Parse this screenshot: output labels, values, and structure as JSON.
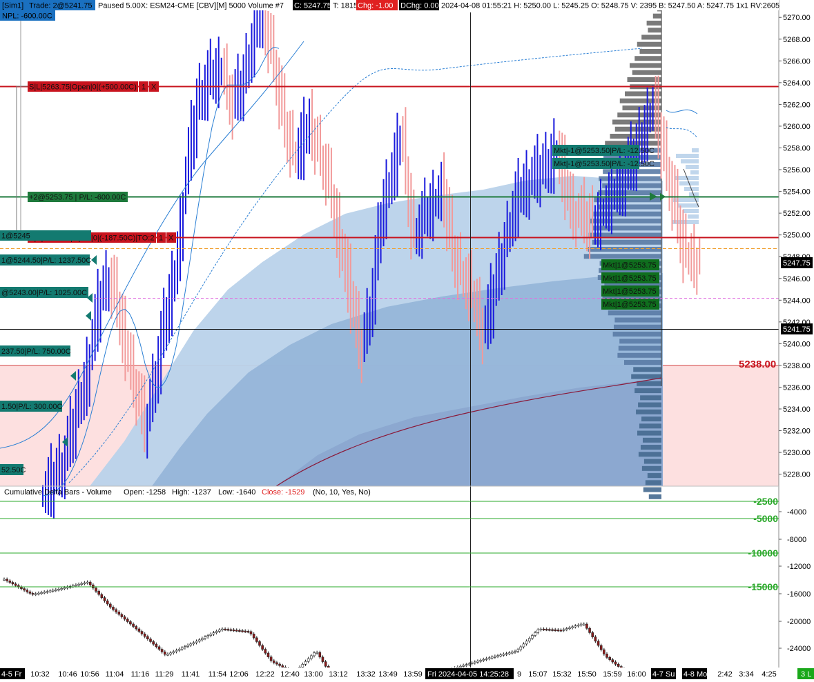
{
  "header": {
    "sim": "[Sim1]",
    "trade": "Trade: 2@5241.75",
    "paused": "Paused 5.00X: ESM24-CME [CBV][M]  5000 Volume #7",
    "close": "C: 5247.75",
    "ticks": "T: 1815",
    "chg": "Chg: -1.00",
    "dchg": "DChg: 0.00",
    "stats": "2024-04-08 01:55:21  H: 5250.00  L: 5245.25  O: 5248.75  V: 2395  B: 5247.50  A: 5247.75  1x1  RV:2605",
    "npl": "NPL: -600.00C"
  },
  "colors": {
    "up_bar": "#1a1adc",
    "down_bar": "#f29a9a",
    "red_line": "#c8141e",
    "green_line": "#1e7a3c",
    "teal_label": "#137a70",
    "dark_green_label": "#0f6e1e",
    "profile_light": "#b9d2ea",
    "profile_mid": "#8fb0d6",
    "profile_dark": "#4e739c",
    "loss_zone": "#fde0e0"
  },
  "orders": {
    "sl_top": "S|L|5263.75|Open|0|(+500.00C)",
    "sl_bottom": "S|S|5250.00|Open|0|(-187.50C)|TO:2",
    "btn_1": "1",
    "btn_x": "X",
    "position": "+2@5253.75 | P/L: -600.00C",
    "mkt_sell_1": "Mkt|-1@5253.50|P/L: -12.50C",
    "mkt_sell_2": "Mkt|-1@5253.50|P/L: -12.50C",
    "mkt_buy_1": "Mkt|1@5253.75",
    "mkt_buy_2": "Mkt|1@5253.75",
    "mkt_buy_3": "Mkt|1@5253.75",
    "mkt_buy_4": "Mkt|1@5253.75",
    "left_1": "1@5245",
    "left_2": "1@5244.50|P/L: 1237.50C",
    "left_3": "@5243.00|P/L: 1025.00C",
    "left_4": "237.50|P/L: 750.00C",
    "left_5": "1.50|P/L: 300.00C",
    "left_6": "52.50C"
  },
  "axis_markers": {
    "current_price": "5247.75",
    "last_trade": "5241.75",
    "stop_level": "5238.00"
  },
  "lower_panel": {
    "title": "Cumulative Delta Bars - Volume",
    "open": "Open: -1258",
    "high": "High: -1237",
    "low": "Low: -1640",
    "close": "Close: -1529",
    "params": "(No, 10, Yes, No)",
    "levels": [
      "-2500",
      "-5000",
      "-10000",
      "-15000"
    ]
  },
  "time_axis": {
    "labels": [
      "10:32",
      "10:46",
      "10:56",
      "11:04",
      "11:16",
      "11:29",
      "11:41",
      "11:54",
      "12:06",
      "12:22",
      "12:40",
      "13:00",
      "13:12",
      "13:32",
      "13:49",
      "13:59",
      "9",
      "15:07",
      "15:32",
      "15:50",
      "15:59",
      "16:00",
      "2:42",
      "3:34",
      "4:25"
    ],
    "session_left": "4-5 Fr",
    "crosshair_time": "Fri 2024-04-05  14:25:28",
    "session_sun": "4-7 Su",
    "session_mon": "4-8 Mo",
    "corner": "3 L"
  },
  "chart_data": [
    {
      "type": "bar",
      "subtype": "ohlc-price-bars",
      "instrument": "ESM24-CME",
      "y_ticks": [
        5228,
        5230,
        5232,
        5234,
        5236,
        5238,
        5240,
        5242,
        5244,
        5246,
        5248,
        5250,
        5252,
        5254,
        5256,
        5258,
        5260,
        5262,
        5264,
        5266,
        5268,
        5270
      ],
      "ylim": [
        5226.9,
        5271.6
      ],
      "levels": {
        "stop_loss": 5263.75,
        "entry_position": 5253.75,
        "second_stop": 5250.0,
        "last_trade": 5241.75,
        "stop_zone_top": 5238.0,
        "current_price": 5247.75
      },
      "price_path": [
        [
          0,
          5226
        ],
        [
          0.04,
          5229
        ],
        [
          0.08,
          5236
        ],
        [
          0.11,
          5244
        ],
        [
          0.13,
          5246
        ],
        [
          0.16,
          5240
        ],
        [
          0.18,
          5236
        ],
        [
          0.2,
          5232
        ],
        [
          0.23,
          5240
        ],
        [
          0.26,
          5247
        ],
        [
          0.28,
          5256
        ],
        [
          0.3,
          5262
        ],
        [
          0.32,
          5264
        ],
        [
          0.35,
          5265
        ],
        [
          0.37,
          5262
        ],
        [
          0.39,
          5264
        ],
        [
          0.41,
          5268
        ],
        [
          0.43,
          5270
        ],
        [
          0.45,
          5266
        ],
        [
          0.47,
          5260
        ],
        [
          0.49,
          5257
        ],
        [
          0.52,
          5260
        ],
        [
          0.55,
          5256
        ],
        [
          0.58,
          5249
        ],
        [
          0.6,
          5244
        ],
        [
          0.62,
          5239
        ],
        [
          0.64,
          5244
        ],
        [
          0.66,
          5252
        ],
        [
          0.7,
          5259
        ],
        [
          0.72,
          5250
        ],
        [
          0.75,
          5252
        ],
        [
          0.78,
          5254
        ],
        [
          0.8,
          5248
        ],
        [
          0.83,
          5245
        ],
        [
          0.86,
          5241
        ],
        [
          0.89,
          5247
        ],
        [
          0.92,
          5253
        ],
        [
          0.95,
          5255
        ],
        [
          0.98,
          5256
        ],
        [
          1.0,
          5258
        ],
        [
          1.03,
          5252
        ],
        [
          1.07,
          5251
        ],
        [
          1.12,
          5254
        ],
        [
          1.16,
          5258
        ],
        [
          1.19,
          5262
        ],
        [
          1.22,
          5255
        ],
        [
          1.25,
          5248
        ],
        [
          1.28,
          5247.75
        ]
      ]
    },
    {
      "type": "bar",
      "subtype": "cumulative-delta",
      "title": "Cumulative Delta Bars - Volume",
      "y_ticks": [
        -4000,
        -8000,
        -12000,
        -16000,
        -20000,
        -24000
      ],
      "ylim": [
        -26600,
        0
      ],
      "reference_levels": [
        -2500,
        -5000,
        -10000,
        -15000
      ],
      "path": [
        [
          0,
          -8200
        ],
        [
          0.05,
          -10400
        ],
        [
          0.1,
          -9600
        ],
        [
          0.15,
          -8600
        ],
        [
          0.19,
          -12200
        ],
        [
          0.24,
          -15600
        ],
        [
          0.29,
          -19200
        ],
        [
          0.34,
          -17400
        ],
        [
          0.39,
          -15400
        ],
        [
          0.44,
          -15800
        ],
        [
          0.48,
          -20100
        ],
        [
          0.52,
          -21800
        ],
        [
          0.56,
          -18600
        ],
        [
          0.6,
          -23800
        ],
        [
          0.64,
          -23200
        ],
        [
          0.68,
          -25400
        ],
        [
          0.72,
          -22600
        ],
        [
          0.77,
          -22000
        ],
        [
          0.82,
          -20800
        ],
        [
          0.87,
          -19600
        ],
        [
          0.92,
          -18600
        ],
        [
          0.96,
          -15400
        ],
        [
          1.0,
          -15600
        ],
        [
          1.04,
          -14600
        ],
        [
          1.08,
          -19400
        ],
        [
          1.13,
          -22600
        ],
        [
          1.18,
          -21400
        ]
      ],
      "last": {
        "open": -1258,
        "high": -1237,
        "low": -1640,
        "close": -1529
      }
    }
  ]
}
